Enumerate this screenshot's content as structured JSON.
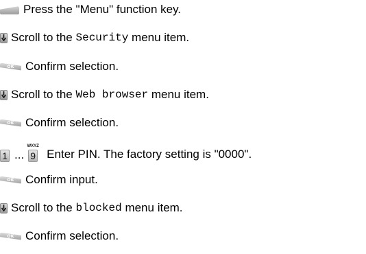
{
  "steps": [
    {
      "key_icon": "menu-key-icon",
      "text": "Press the \"Menu\" function key."
    },
    {
      "key_icon": "scroll-key-icon",
      "before": "Scroll to the ",
      "mono": "Security",
      "after": " menu item."
    },
    {
      "key_icon": "ok-key-icon",
      "text": "Confirm selection."
    },
    {
      "key_icon": "scroll-key-icon",
      "before": "Scroll to the ",
      "mono": "Web browser",
      "after": " menu item."
    },
    {
      "key_icon": "ok-key-icon",
      "text": "Confirm selection."
    },
    {
      "key_icon": "number-keys-icon",
      "range_sep": "...",
      "text": "Enter PIN. The factory setting is \"0000\"."
    },
    {
      "key_icon": "ok-key-icon",
      "text": "Confirm input."
    },
    {
      "key_icon": "scroll-key-icon",
      "before": "Scroll to the ",
      "mono": "blocked",
      "after": " menu item."
    },
    {
      "key_icon": "ok-key-icon",
      "text": "Confirm selection."
    }
  ],
  "keys": {
    "ok_label": "OK",
    "num_first": "1",
    "num_last": "9",
    "num_last_letters": "WXYZ"
  }
}
